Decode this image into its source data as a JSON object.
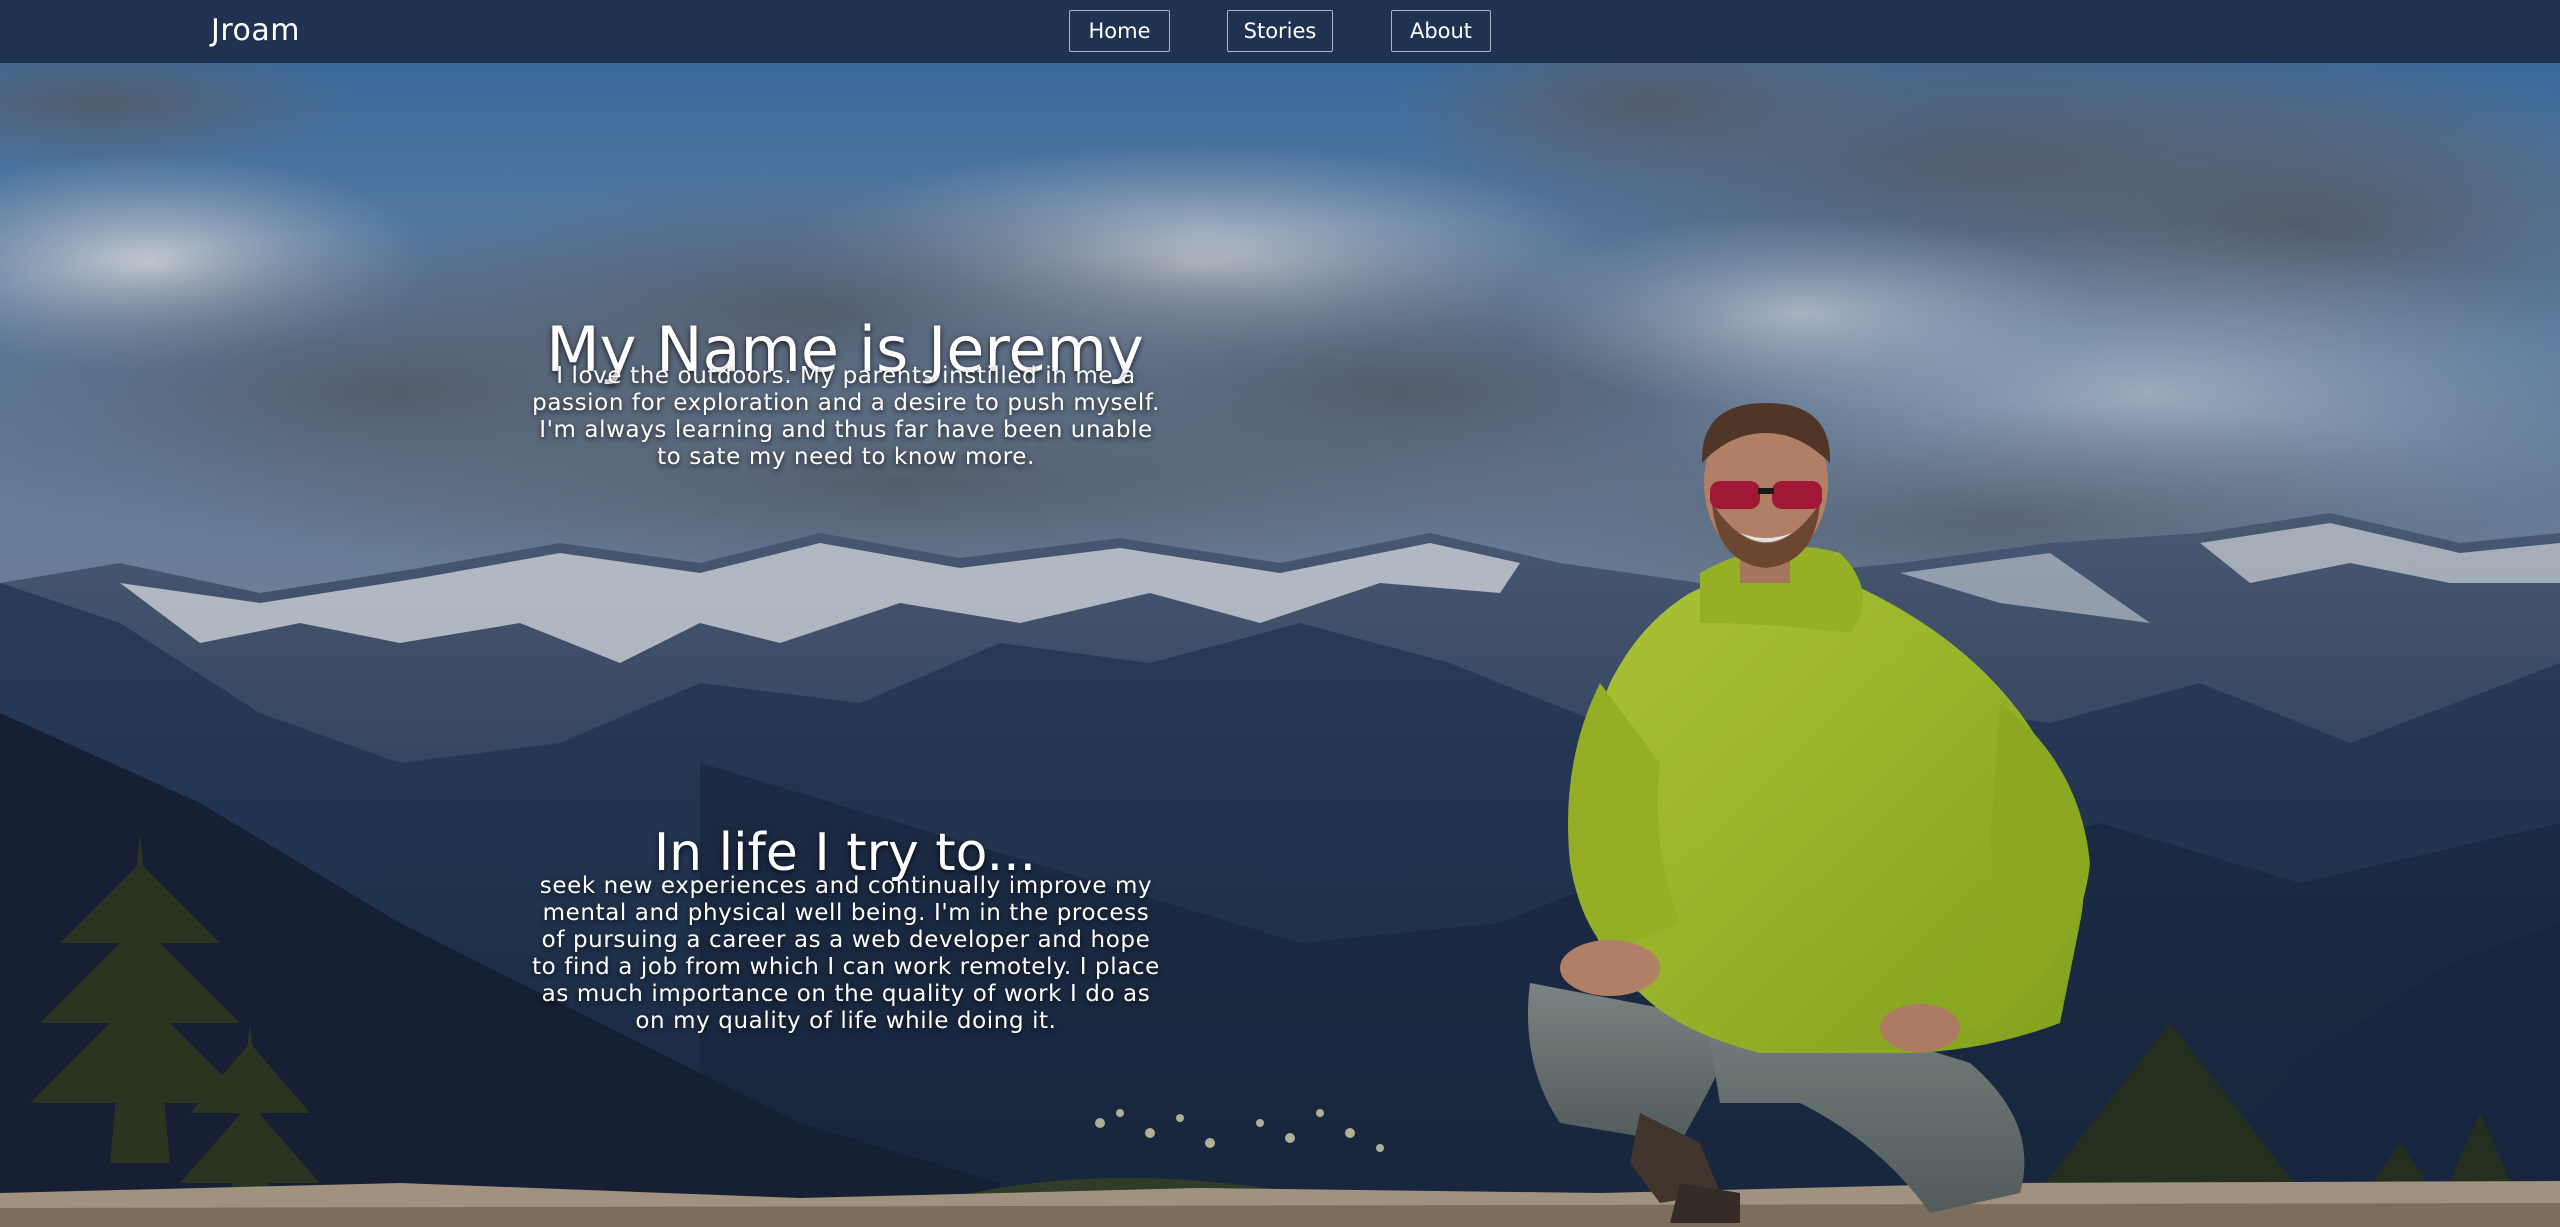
{
  "navbar": {
    "brand": "Jroam",
    "links": [
      {
        "label": "Home"
      },
      {
        "label": "Stories"
      },
      {
        "label": "About"
      }
    ],
    "background": "#1f3350"
  },
  "hero": {
    "title": "My Name is Jeremy",
    "intro": "I love the outdoors. My parents instilled in me a passion for exploration and a desire to push myself. I'm always learning and thus far have been unable to sate my need to know more.",
    "subtitle": "In life I try to...",
    "body": "seek new experiences and continually improve my mental and physical well being. I'm in the process of pursuing a career as a web developer and hope to find a job from which I can work remotely. I place as much importance on the quality of work I do as on my quality of life while doing it.",
    "image": "mountain-portrait-photo",
    "colors": {
      "jacket": "#b5d22c",
      "sky": "#4a7db0",
      "mountains": "#2a3b57"
    }
  }
}
